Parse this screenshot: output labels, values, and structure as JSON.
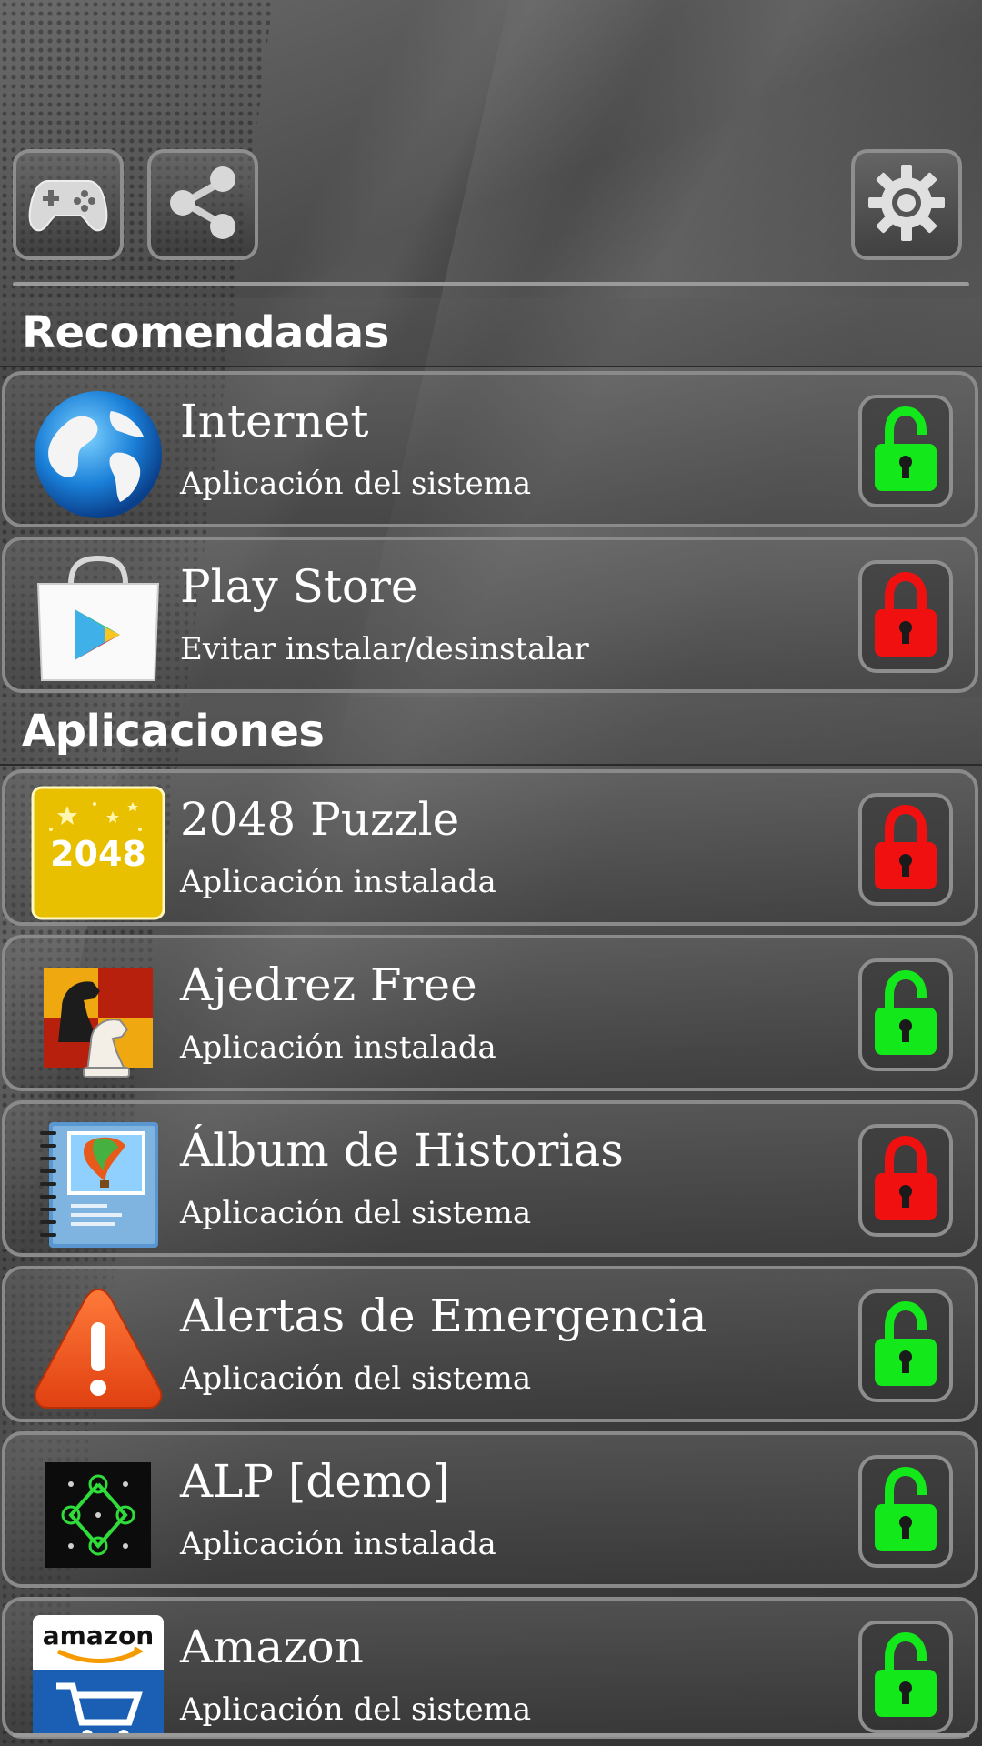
{
  "toolbar": {
    "games_icon": "gamepad-icon",
    "share_icon": "share-icon",
    "settings_icon": "gear-icon"
  },
  "sections": {
    "recommended": "Recomendadas",
    "apps": "Aplicaciones"
  },
  "colors": {
    "lock_unlocked": "#12e81a",
    "lock_locked": "#f01010"
  },
  "recommended": [
    {
      "name": "Internet",
      "subtitle": "Aplicación del sistema",
      "icon": "globe-icon",
      "locked": false
    },
    {
      "name": "Play Store",
      "subtitle": "Evitar instalar/desinstalar",
      "icon": "play-store-icon",
      "locked": true
    }
  ],
  "apps": [
    {
      "name": "2048 Puzzle",
      "subtitle": "Aplicación instalada",
      "icon": "2048-icon",
      "icon_text": "2048",
      "locked": true
    },
    {
      "name": "Ajedrez Free",
      "subtitle": "Aplicación instalada",
      "icon": "chess-icon",
      "locked": false
    },
    {
      "name": "Álbum de Historias",
      "subtitle": "Aplicación del sistema",
      "icon": "story-album-icon",
      "locked": true
    },
    {
      "name": "Alertas de Emergencia",
      "subtitle": "Aplicación del sistema",
      "icon": "warning-icon",
      "locked": false
    },
    {
      "name": "ALP [demo]",
      "subtitle": "Aplicación instalada",
      "icon": "pattern-lock-icon",
      "locked": false
    },
    {
      "name": "Amazon",
      "subtitle": "Aplicación del sistema",
      "icon": "amazon-icon",
      "icon_text": "amazon",
      "locked": false
    }
  ]
}
